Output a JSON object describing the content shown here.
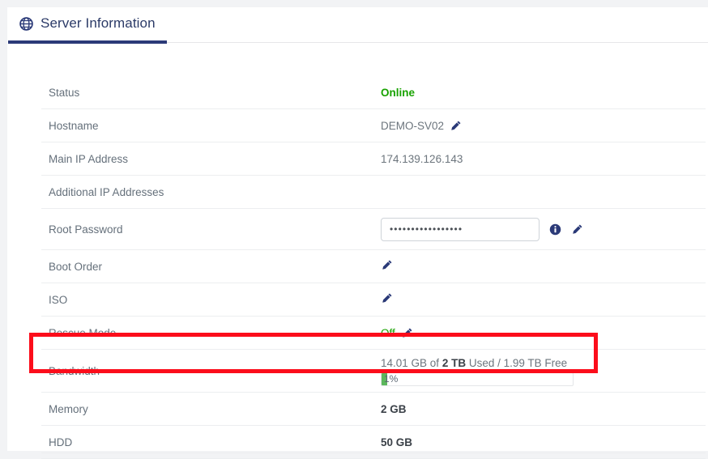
{
  "tab": {
    "label": "Server Information",
    "icon": "globe-icon"
  },
  "rows": [
    {
      "label": "Status",
      "value": "Online",
      "style": "online"
    },
    {
      "label": "Hostname",
      "value": "DEMO-SV02",
      "style": "plain",
      "edit": true
    },
    {
      "label": "Main IP Address",
      "value": "174.139.126.143",
      "style": "plain"
    },
    {
      "label": "Additional IP Addresses",
      "value": "",
      "style": "plain"
    },
    {
      "label": "Root Password",
      "value": "",
      "style": "password"
    },
    {
      "label": "Boot Order",
      "value": "",
      "style": "plain",
      "edit": true
    },
    {
      "label": "ISO",
      "value": "",
      "style": "plain",
      "edit": true
    },
    {
      "label": "Rescue Mode",
      "value": "Off",
      "style": "off",
      "edit": true
    },
    {
      "label": "Bandwidth",
      "value": "",
      "style": "bandwidth"
    },
    {
      "label": "Memory",
      "value": "2 GB",
      "style": "strong"
    },
    {
      "label": "HDD",
      "value": "50 GB",
      "style": "strong"
    }
  ],
  "root_password": {
    "value": "•••••••••••••••••",
    "placeholder": "",
    "info_icon": "info-circle-icon",
    "edit_icon": "pencil-icon"
  },
  "bandwidth": {
    "used": "14.01 GB",
    "of_text": " of ",
    "total": "2 TB",
    "used_suffix": " Used / ",
    "free": "1.99 TB Free",
    "full_text": "14.01 GB of 2 TB Used / 1.99 TB Free",
    "percent_label": "1%",
    "percent_value": 1,
    "bar_color": "#5cb85c"
  },
  "colors": {
    "accent_navy": "#2b3a78",
    "status_green": "#18a200",
    "label_gray": "#65707b",
    "value_gray": "#6c757d",
    "highlight_red": "#fc0d1b",
    "page_bg": "#f2f3f5"
  },
  "annotation": {
    "highlight_target": "Bandwidth"
  }
}
